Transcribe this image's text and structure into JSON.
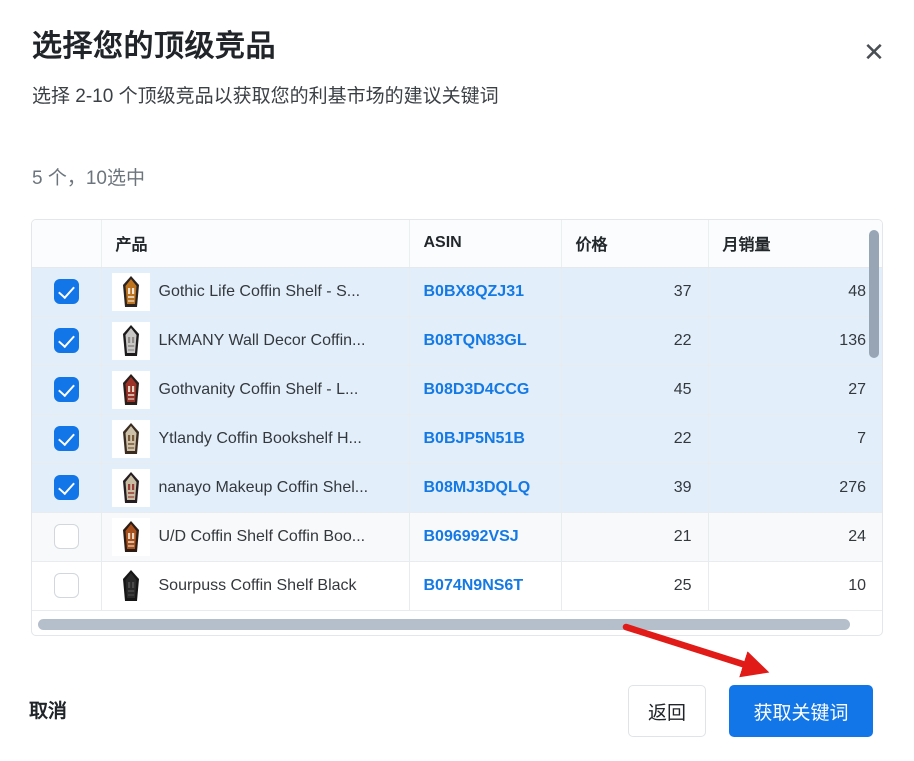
{
  "dialog": {
    "title": "选择您的顶级竞品",
    "subtitle": "选择 2-10 个顶级竞品以获取您的利基市场的建议关键词",
    "close_icon": "close-icon",
    "count_label": "5 个，10选中"
  },
  "table": {
    "columns": [
      "",
      "产品",
      "ASIN",
      "价格",
      "月销量"
    ],
    "rows": [
      {
        "selected": true,
        "name": "Gothic Life Coffin Shelf - S...",
        "asin": "B0BX8QZJ31",
        "price": "37",
        "sales": "48"
      },
      {
        "selected": true,
        "name": "LKMANY Wall Decor Coffin...",
        "asin": "B08TQN83GL",
        "price": "22",
        "sales": "136"
      },
      {
        "selected": true,
        "name": "Gothvanity Coffin Shelf - L...",
        "asin": "B08D3D4CCG",
        "price": "45",
        "sales": "27"
      },
      {
        "selected": true,
        "name": "Ytlandy Coffin Bookshelf H...",
        "asin": "B0BJP5N51B",
        "price": "22",
        "sales": "7"
      },
      {
        "selected": true,
        "name": "nanayo Makeup Coffin Shel...",
        "asin": "B08MJ3DQLQ",
        "price": "39",
        "sales": "276"
      },
      {
        "selected": false,
        "name": "U/D Coffin Shelf Coffin Boo...",
        "asin": "B096992VSJ",
        "price": "21",
        "sales": "24"
      },
      {
        "selected": false,
        "name": "Sourpuss Coffin Shelf Black",
        "asin": "B074N9NS6T",
        "price": "25",
        "sales": "10"
      }
    ]
  },
  "footer": {
    "cancel_label": "取消",
    "back_label": "返回",
    "primary_label": "获取关键词"
  },
  "colors": {
    "primary": "#1276e8",
    "link": "#1479e4",
    "selected_row": "#e2effb",
    "annotation_arrow": "#e01b18"
  }
}
